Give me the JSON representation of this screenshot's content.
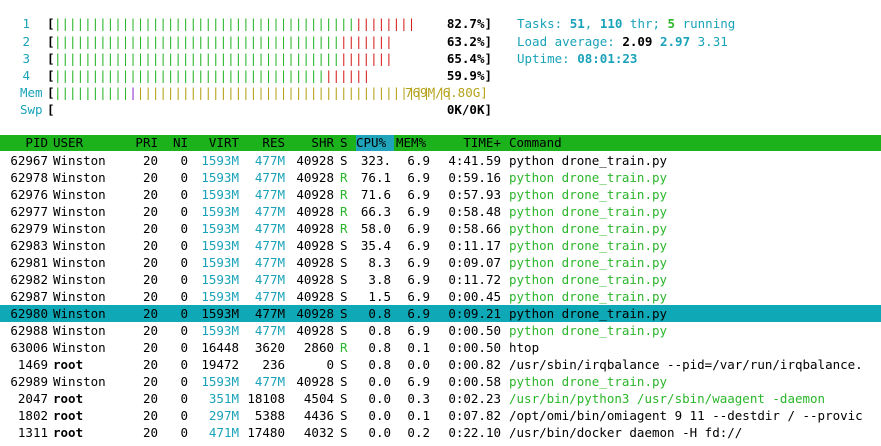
{
  "meters": {
    "cpus": [
      {
        "label": "1",
        "green": "||||||||||||||||||||||||||||||||||||||||",
        "red": "||||||||",
        "value": "82.7%]"
      },
      {
        "label": "2",
        "green": "||||||||||||||||||||||||||||||||||||||",
        "red": "|||||||",
        "value": "63.2%]"
      },
      {
        "label": "3",
        "green": "||||||||||||||||||||||||||||||||||||||",
        "red": "|||||||",
        "value": "65.4%]"
      },
      {
        "label": "4",
        "green": "||||||||||||||||||||||||||||||||||||",
        "red": "||||||",
        "value": "59.9%]"
      }
    ],
    "mem": {
      "label": "Mem",
      "green": "||||||||||",
      "blue": "|",
      "olive": "||||||||||||||||||||||||||||||||||||||||||",
      "tail": "769M/6.80G]"
    },
    "swp": {
      "label": "Swp",
      "value": "0K/0K]"
    }
  },
  "summary": {
    "tasks_label": "Tasks: ",
    "tasks": "51",
    "sep1": ", ",
    "threads": "110",
    "thr_label": " thr; ",
    "running": "5",
    "running_label": " running",
    "load_label": "Load average: ",
    "load1": "2.09",
    "load5": "2.97",
    "load15": "3.31",
    "uptime_label": "Uptime: ",
    "uptime": "08:01:23"
  },
  "columns": {
    "pid": "PID",
    "user": "USER",
    "pri": "PRI",
    "ni": "NI",
    "virt": "VIRT",
    "res": "RES",
    "shr": "SHR",
    "s": "S",
    "cpu": "CPU%",
    "mem": "MEM%",
    "time": "TIME+",
    "cmd": "Command"
  },
  "processes": [
    {
      "pid": "62967",
      "user": "Winston",
      "pri": "20",
      "ni": "0",
      "virt": "1593M",
      "res": "477M",
      "shr": "40928",
      "s": "S",
      "cpu": "323.",
      "mem": "6.9",
      "time": "4:41.59",
      "cmd": "python drone_train.py"
    },
    {
      "pid": "62978",
      "user": "Winston",
      "pri": "20",
      "ni": "0",
      "virt": "1593M",
      "res": "477M",
      "shr": "40928",
      "s": "R",
      "cpu": "76.1",
      "mem": "6.9",
      "time": "0:59.16",
      "cmd": "python drone_train.py"
    },
    {
      "pid": "62976",
      "user": "Winston",
      "pri": "20",
      "ni": "0",
      "virt": "1593M",
      "res": "477M",
      "shr": "40928",
      "s": "R",
      "cpu": "71.6",
      "mem": "6.9",
      "time": "0:57.93",
      "cmd": "python drone_train.py"
    },
    {
      "pid": "62977",
      "user": "Winston",
      "pri": "20",
      "ni": "0",
      "virt": "1593M",
      "res": "477M",
      "shr": "40928",
      "s": "R",
      "cpu": "66.3",
      "mem": "6.9",
      "time": "0:58.48",
      "cmd": "python drone_train.py"
    },
    {
      "pid": "62979",
      "user": "Winston",
      "pri": "20",
      "ni": "0",
      "virt": "1593M",
      "res": "477M",
      "shr": "40928",
      "s": "R",
      "cpu": "58.0",
      "mem": "6.9",
      "time": "0:58.66",
      "cmd": "python drone_train.py"
    },
    {
      "pid": "62983",
      "user": "Winston",
      "pri": "20",
      "ni": "0",
      "virt": "1593M",
      "res": "477M",
      "shr": "40928",
      "s": "S",
      "cpu": "35.4",
      "mem": "6.9",
      "time": "0:11.17",
      "cmd": "python drone_train.py"
    },
    {
      "pid": "62981",
      "user": "Winston",
      "pri": "20",
      "ni": "0",
      "virt": "1593M",
      "res": "477M",
      "shr": "40928",
      "s": "S",
      "cpu": "8.3",
      "mem": "6.9",
      "time": "0:09.07",
      "cmd": "python drone_train.py"
    },
    {
      "pid": "62982",
      "user": "Winston",
      "pri": "20",
      "ni": "0",
      "virt": "1593M",
      "res": "477M",
      "shr": "40928",
      "s": "S",
      "cpu": "3.8",
      "mem": "6.9",
      "time": "0:11.72",
      "cmd": "python drone_train.py"
    },
    {
      "pid": "62987",
      "user": "Winston",
      "pri": "20",
      "ni": "0",
      "virt": "1593M",
      "res": "477M",
      "shr": "40928",
      "s": "S",
      "cpu": "1.5",
      "mem": "6.9",
      "time": "0:00.45",
      "cmd": "python drone_train.py"
    },
    {
      "pid": "62980",
      "user": "Winston",
      "pri": "20",
      "ni": "0",
      "virt": "1593M",
      "res": "477M",
      "shr": "40928",
      "s": "S",
      "cpu": "0.8",
      "mem": "6.9",
      "time": "0:09.21",
      "cmd": "python drone_train.py",
      "selected": true
    },
    {
      "pid": "62988",
      "user": "Winston",
      "pri": "20",
      "ni": "0",
      "virt": "1593M",
      "res": "477M",
      "shr": "40928",
      "s": "S",
      "cpu": "0.8",
      "mem": "6.9",
      "time": "0:00.50",
      "cmd": "python drone_train.py"
    },
    {
      "pid": "63006",
      "user": "Winston",
      "pri": "20",
      "ni": "0",
      "virt": "16448",
      "res": "3620",
      "shr": "2860",
      "s": "R",
      "cpu": "0.8",
      "mem": "0.1",
      "time": "0:00.50",
      "cmd": "htop"
    },
    {
      "pid": "1469",
      "user": "root",
      "pri": "20",
      "ni": "0",
      "virt": "19472",
      "res": "236",
      "shr": "0",
      "s": "S",
      "cpu": "0.8",
      "mem": "0.0",
      "time": "0:00.82",
      "cmd": "/usr/sbin/irqbalance --pid=/var/run/irqbalance."
    },
    {
      "pid": "62989",
      "user": "Winston",
      "pri": "20",
      "ni": "0",
      "virt": "1593M",
      "res": "477M",
      "shr": "40928",
      "s": "S",
      "cpu": "0.0",
      "mem": "6.9",
      "time": "0:00.58",
      "cmd": "python drone_train.py"
    },
    {
      "pid": "2047",
      "user": "root",
      "pri": "20",
      "ni": "0",
      "virt": "351M",
      "res": "18108",
      "shr": "4504",
      "s": "S",
      "cpu": "0.0",
      "mem": "0.3",
      "time": "0:02.23",
      "cmd": "/usr/bin/python3 /usr/sbin/waagent -daemon"
    },
    {
      "pid": "1802",
      "user": "root",
      "pri": "20",
      "ni": "0",
      "virt": "297M",
      "res": "5388",
      "shr": "4436",
      "s": "S",
      "cpu": "0.0",
      "mem": "0.1",
      "time": "0:07.82",
      "cmd": "/opt/omi/bin/omiagent 9 11 --destdir / --provic"
    },
    {
      "pid": "1311",
      "user": "root",
      "pri": "20",
      "ni": "0",
      "virt": "471M",
      "res": "17480",
      "shr": "4032",
      "s": "S",
      "cpu": "0.0",
      "mem": "0.2",
      "time": "0:22.10",
      "cmd": "/usr/bin/docker daemon -H fd://"
    }
  ]
}
